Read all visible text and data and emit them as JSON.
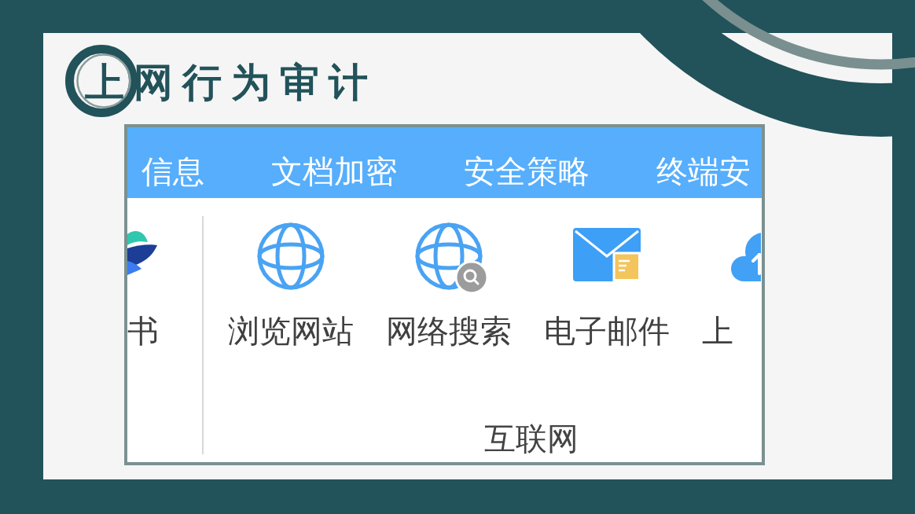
{
  "slide": {
    "title": "上网行为审计"
  },
  "screenshot": {
    "tabs": [
      {
        "label": "信息"
      },
      {
        "label": "文档加密"
      },
      {
        "label": "安全策略"
      },
      {
        "label": "终端安"
      }
    ],
    "ribbon": {
      "partial_item": {
        "label": "书"
      },
      "groups": [
        {
          "label": "互联网",
          "items": [
            {
              "kind": "globe",
              "label": "浏览网站"
            },
            {
              "kind": "globe-search",
              "label": "网络搜索"
            },
            {
              "kind": "mail",
              "label": "电子邮件"
            },
            {
              "kind": "cloud",
              "label": "上"
            }
          ]
        }
      ]
    }
  }
}
